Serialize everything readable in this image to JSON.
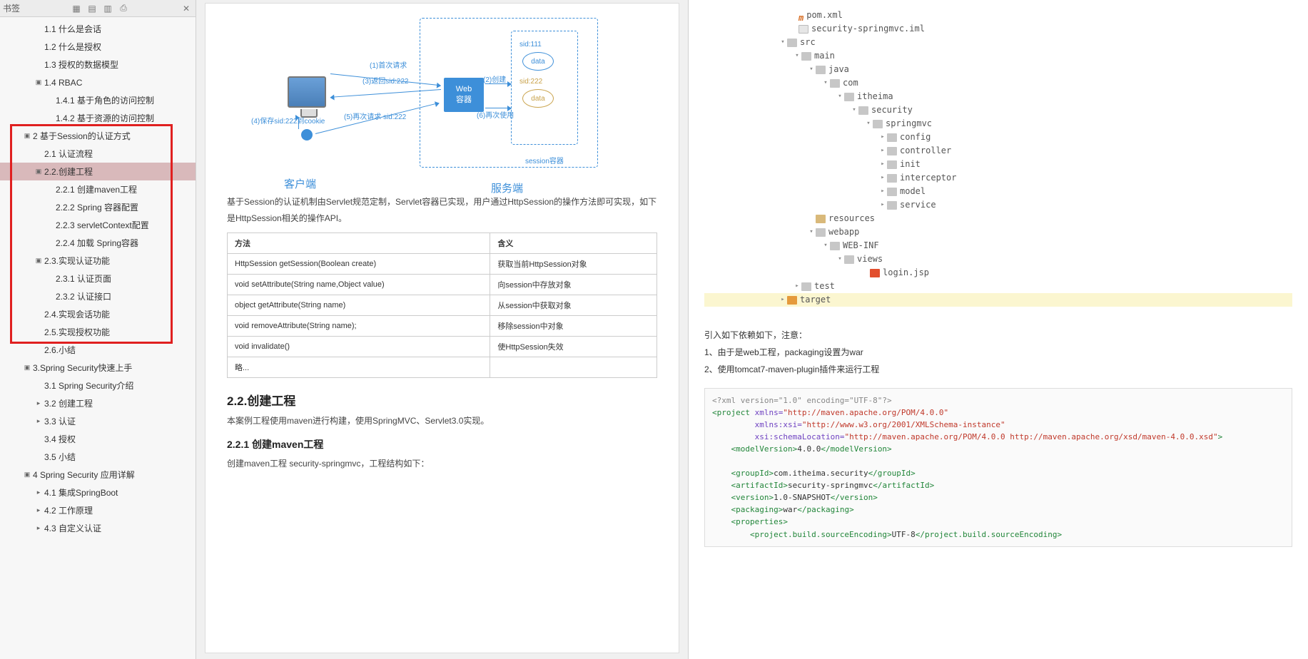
{
  "sidebar": {
    "title": "书签",
    "items": [
      {
        "lvl": 2,
        "tw": "",
        "label": "1.1 什么是会话"
      },
      {
        "lvl": 2,
        "tw": "",
        "label": "1.2 什么是授权"
      },
      {
        "lvl": 2,
        "tw": "",
        "label": "1.3 授权的数据模型"
      },
      {
        "lvl": 2,
        "tw": "▣",
        "label": "1.4 RBAC"
      },
      {
        "lvl": 3,
        "tw": "",
        "label": "1.4.1 基于角色的访问控制"
      },
      {
        "lvl": 3,
        "tw": "",
        "label": "1.4.2 基于资源的访问控制"
      },
      {
        "lvl": 1,
        "tw": "▣",
        "label": "2 基于Session的认证方式"
      },
      {
        "lvl": 2,
        "tw": "",
        "label": "2.1 认证流程"
      },
      {
        "lvl": 2,
        "tw": "▣",
        "label": "2.2.创建工程",
        "sel": true
      },
      {
        "lvl": 3,
        "tw": "",
        "label": "2.2.1 创建maven工程"
      },
      {
        "lvl": 3,
        "tw": "",
        "label": "2.2.2  Spring 容器配置"
      },
      {
        "lvl": 3,
        "tw": "",
        "label": "2.2.3 servletContext配置"
      },
      {
        "lvl": 3,
        "tw": "",
        "label": "2.2.4 加载 Spring容器"
      },
      {
        "lvl": 2,
        "tw": "▣",
        "label": "2.3.实现认证功能"
      },
      {
        "lvl": 3,
        "tw": "",
        "label": "2.3.1 认证页面"
      },
      {
        "lvl": 3,
        "tw": "",
        "label": "2.3.2 认证接口"
      },
      {
        "lvl": 2,
        "tw": "",
        "label": "2.4.实现会话功能"
      },
      {
        "lvl": 2,
        "tw": "",
        "label": "2.5.实现授权功能"
      },
      {
        "lvl": 2,
        "tw": "",
        "label": "2.6.小结"
      },
      {
        "lvl": 1,
        "tw": "▣",
        "label": "3.Spring Security快速上手"
      },
      {
        "lvl": 2,
        "tw": "",
        "label": "3.1 Spring Security介绍"
      },
      {
        "lvl": 2,
        "tw": "▸",
        "label": "3.2 创建工程"
      },
      {
        "lvl": 2,
        "tw": "▸",
        "label": "3.3 认证"
      },
      {
        "lvl": 2,
        "tw": "",
        "label": "3.4 授权"
      },
      {
        "lvl": 2,
        "tw": "",
        "label": "3.5 小结"
      },
      {
        "lvl": 1,
        "tw": "▣",
        "label": "4 Spring Security 应用详解"
      },
      {
        "lvl": 2,
        "tw": "▸",
        "label": "4.1 集成SpringBoot"
      },
      {
        "lvl": 2,
        "tw": "▸",
        "label": "4.2 工作原理"
      },
      {
        "lvl": 2,
        "tw": "▸",
        "label": "4.3 自定义认证"
      }
    ]
  },
  "diagram": {
    "client_label": "客户端",
    "server_label": "服务端",
    "web_line1": "Web",
    "web_line2": "容器",
    "sid1": "sid:111",
    "sid2": "sid:222",
    "data": "data",
    "session_label": "session容器",
    "t1": "(1)首次请求",
    "t2": "(2)创建",
    "t3": "(3)返回sid:222",
    "t4": "(4)保存sid:222到cookie",
    "t5": "(5)再次请求 sid:222",
    "t6": "(6)再次使用"
  },
  "doc": {
    "intro": "基于Session的认证机制由Servlet规范定制，Servlet容器已实现，用户通过HttpSession的操作方法即可实现，如下是HttpSession相关的操作API。",
    "th1": "方法",
    "th2": "含义",
    "rows": [
      [
        "HttpSession getSession(Boolean create)",
        "获取当前HttpSession对象"
      ],
      [
        "void setAttribute(String name,Object value)",
        "向session中存放对象"
      ],
      [
        "object getAttribute(String name)",
        "从session中获取对象"
      ],
      [
        "void removeAttribute(String name);",
        "移除session中对象"
      ],
      [
        "void invalidate()",
        "使HttpSession失效"
      ],
      [
        "略...",
        ""
      ]
    ],
    "h2": "2.2.创建工程",
    "h2p": "本案例工程使用maven进行构建，使用SpringMVC、Servlet3.0实现。",
    "h3": "2.2.1 创建maven工程",
    "h3p": "创建maven工程 security-springmvc，工程结构如下："
  },
  "tree": [
    {
      "ind": 120,
      "tw": "",
      "ico": "m",
      "label": "pom.xml"
    },
    {
      "ind": 120,
      "tw": "",
      "ico": "file",
      "label": "security-springmvc.iml"
    },
    {
      "ind": 104,
      "tw": "▾",
      "ico": "folder dim",
      "label": "src"
    },
    {
      "ind": 124,
      "tw": "▾",
      "ico": "folder dim",
      "label": "main"
    },
    {
      "ind": 144,
      "tw": "▾",
      "ico": "folder dim",
      "label": "java"
    },
    {
      "ind": 164,
      "tw": "▾",
      "ico": "folder dim",
      "label": "com"
    },
    {
      "ind": 184,
      "tw": "▾",
      "ico": "folder dim",
      "label": "itheima"
    },
    {
      "ind": 204,
      "tw": "▾",
      "ico": "folder dim",
      "label": "security"
    },
    {
      "ind": 224,
      "tw": "▾",
      "ico": "folder dim",
      "label": "springmvc"
    },
    {
      "ind": 244,
      "tw": "▸",
      "ico": "folder dim",
      "label": "config"
    },
    {
      "ind": 244,
      "tw": "▸",
      "ico": "folder dim",
      "label": "controller"
    },
    {
      "ind": 244,
      "tw": "▸",
      "ico": "folder dim",
      "label": "init"
    },
    {
      "ind": 244,
      "tw": "▸",
      "ico": "folder dim",
      "label": "interceptor"
    },
    {
      "ind": 244,
      "tw": "▸",
      "ico": "folder dim",
      "label": "model"
    },
    {
      "ind": 244,
      "tw": "▸",
      "ico": "folder dim",
      "label": "service"
    },
    {
      "ind": 144,
      "tw": "",
      "ico": "folder",
      "label": "resources"
    },
    {
      "ind": 144,
      "tw": "▾",
      "ico": "folder dim",
      "label": "webapp"
    },
    {
      "ind": 164,
      "tw": "▾",
      "ico": "folder dim",
      "label": "WEB-INF"
    },
    {
      "ind": 184,
      "tw": "▾",
      "ico": "folder dim",
      "label": "views"
    },
    {
      "ind": 220,
      "tw": "",
      "ico": "jsp",
      "label": "login.jsp"
    },
    {
      "ind": 124,
      "tw": "▸",
      "ico": "folder dim",
      "label": "test"
    },
    {
      "ind": 104,
      "tw": "▸",
      "ico": "folder orange",
      "label": "target",
      "hl": true
    }
  ],
  "notes": {
    "n0": "引入如下依赖如下，注意：",
    "n1": "1、由于是web工程，packaging设置为war",
    "n2": "2、使用tomcat7-maven-plugin插件来运行工程"
  },
  "xml": {
    "decl": "<?xml version=\"1.0\" encoding=\"UTF-8\"?>",
    "ns1": "http://maven.apache.org/POM/4.0.0",
    "ns2": "http://www.w3.org/2001/XMLSchema-instance",
    "loc": "http://maven.apache.org/POM/4.0.0 http://maven.apache.org/xsd/maven-4.0.0.xsd",
    "modelVersion": "4.0.0",
    "groupId": "com.itheima.security",
    "artifactId": "security-springmvc",
    "version": "1.0-SNAPSHOT",
    "packaging": "war",
    "enc": "UTF-8"
  }
}
